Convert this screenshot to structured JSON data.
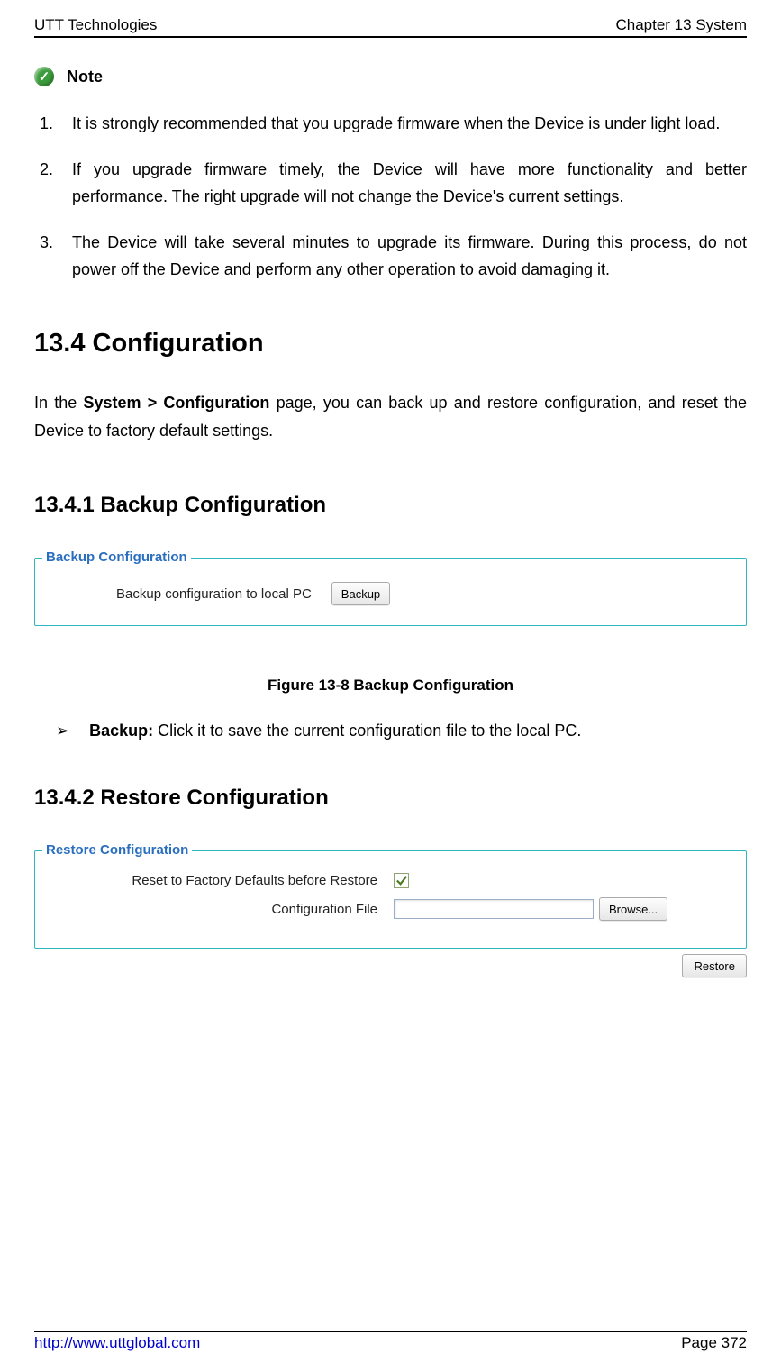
{
  "header": {
    "left": "UTT Technologies",
    "right": "Chapter 13 System"
  },
  "note": {
    "label": "Note"
  },
  "list": {
    "items": [
      "It is strongly recommended that you upgrade firmware when the Device is under light load.",
      "If you upgrade firmware timely, the Device will have more functionality and better performance. The right upgrade will not change the Device's current settings.",
      "The Device will take several minutes to upgrade its firmware. During this process, do not power off the Device and perform any other operation to avoid damaging it."
    ]
  },
  "sections": {
    "configuration_title": "13.4   Configuration",
    "configuration_para_pre": "In the ",
    "configuration_para_bold": "System > Configuration",
    "configuration_para_post": " page, you can back up and restore configuration, and reset the Device to factory default settings.",
    "backup_title": "13.4.1  Backup Configuration",
    "restore_title": "13.4.2  Restore Configuration"
  },
  "backup_panel": {
    "legend": "Backup Configuration",
    "label": "Backup configuration to local PC",
    "button": "Backup"
  },
  "figure_caption": "Figure 13-8 Backup Configuration",
  "bullet": {
    "symbol": "➢",
    "bold": "Backup:",
    "text": " Click it to save the current configuration file to the local PC."
  },
  "restore_panel": {
    "legend": "Restore Configuration",
    "reset_label": "Reset to Factory Defaults before Restore",
    "file_label": "Configuration File",
    "browse_button": "Browse...",
    "restore_button": "Restore"
  },
  "footer": {
    "url": "http://www.uttglobal.com",
    "page": "Page 372"
  }
}
